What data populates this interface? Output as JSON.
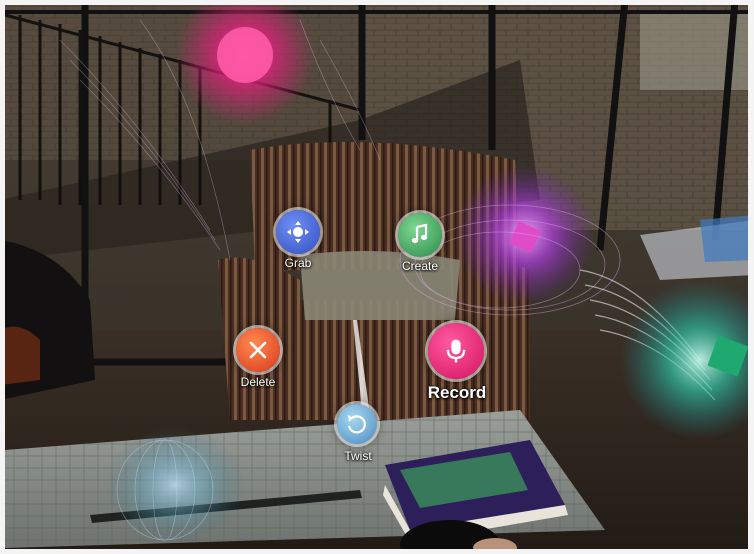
{
  "menu": {
    "grab": {
      "label": "Grab",
      "icon": "grab-move-icon",
      "color": "#3b5fcf"
    },
    "create": {
      "label": "Create",
      "icon": "music-note-icon",
      "color": "#2f9c5a"
    },
    "delete": {
      "label": "Delete",
      "icon": "close-x-icon",
      "color": "#e0492a"
    },
    "record": {
      "label": "Record",
      "icon": "microphone-icon",
      "color": "#e0206e"
    },
    "twist": {
      "label": "Twist",
      "icon": "rotate-icon",
      "color": "#5b9bd0"
    }
  }
}
